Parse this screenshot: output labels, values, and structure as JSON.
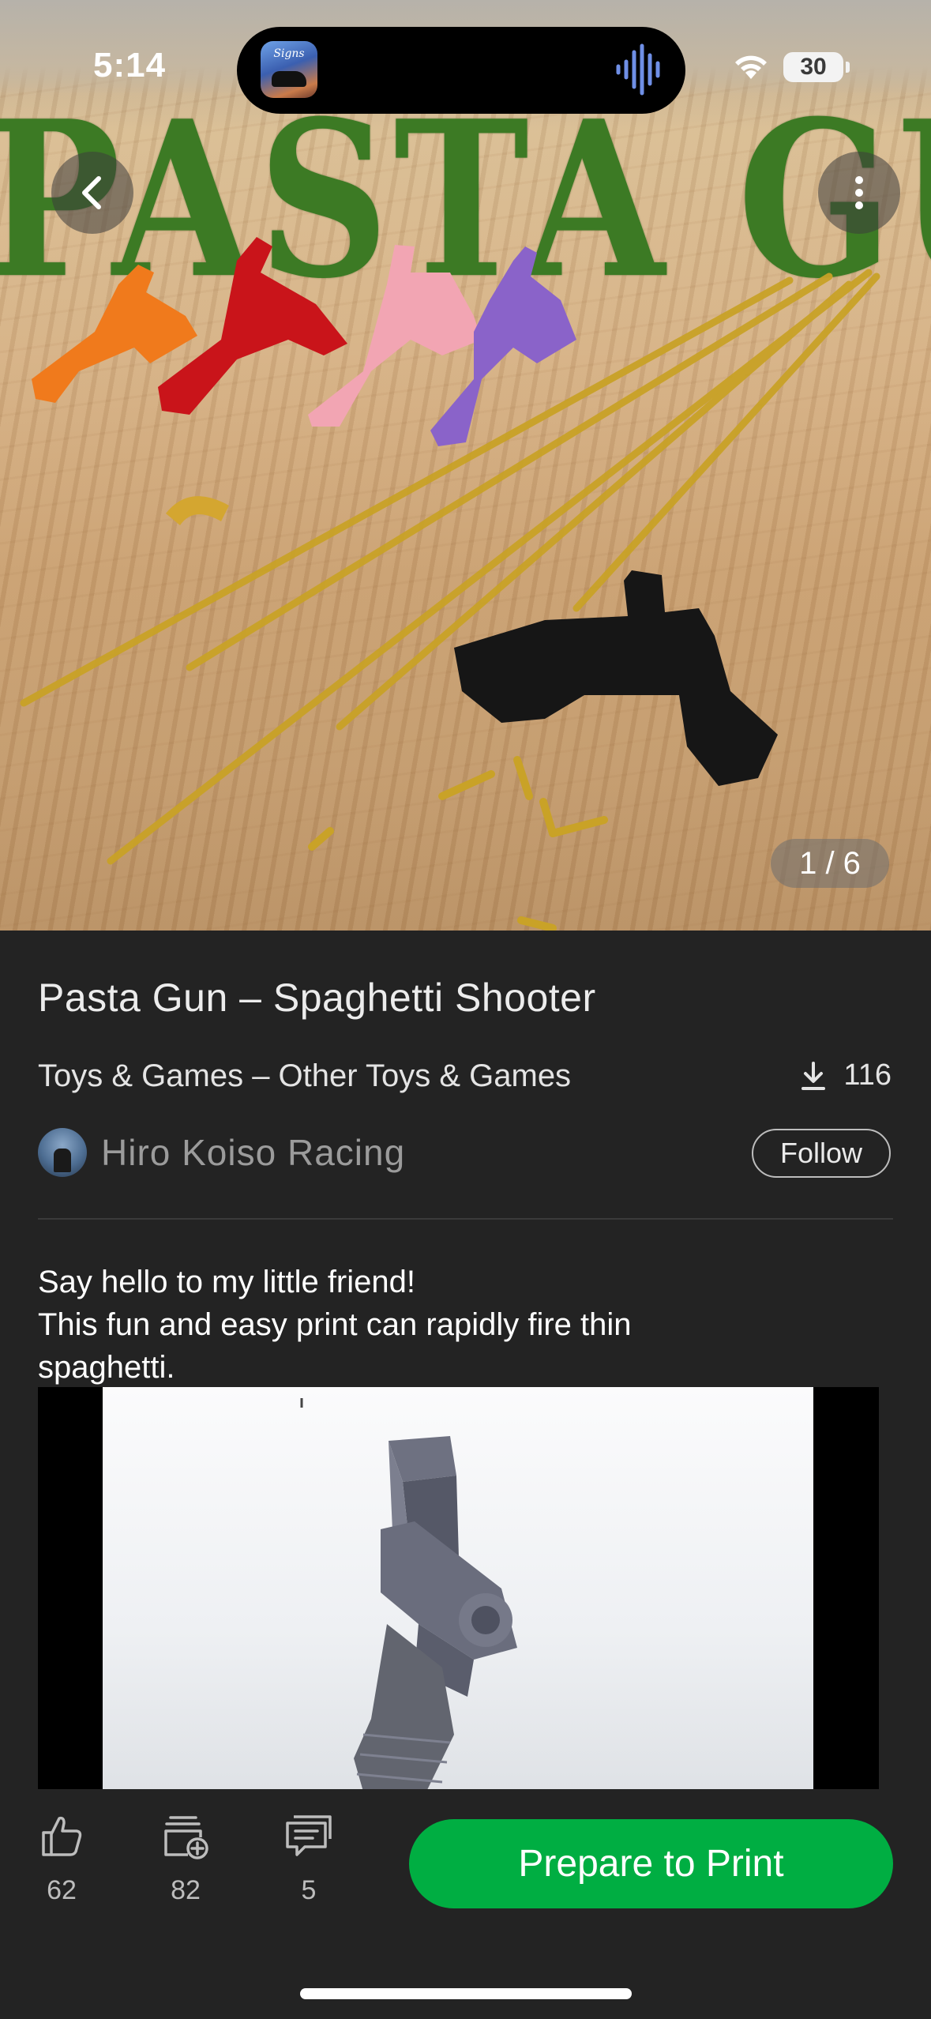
{
  "status_bar": {
    "time": "5:14",
    "battery": "30",
    "now_playing_art_text": "Signs"
  },
  "hero": {
    "overlay_text": "PASTA GUN",
    "image_counter": "1 / 6"
  },
  "model": {
    "title": "Pasta Gun – Spaghetti Shooter",
    "category": "Toys & Games – Other Toys & Games",
    "downloads": "116"
  },
  "author": {
    "name": "Hiro Koiso Racing",
    "follow_label": "Follow"
  },
  "description": {
    "lines": [
      "Say hello to my little friend!",
      "This fun and easy print can rapidly fire thin",
      "spaghetti."
    ]
  },
  "actions": {
    "likes": "62",
    "collects": "82",
    "comments": "5",
    "primary_label": "Prepare to Print"
  },
  "colors": {
    "accent_green": "#00ae42",
    "background": "#232323",
    "hero_text_green": "#3c7a24"
  },
  "icons": [
    "back-icon",
    "more-icon",
    "download-icon",
    "like-icon",
    "collect-icon",
    "comment-icon",
    "wifi-icon",
    "battery-icon",
    "audio-wave-icon"
  ]
}
